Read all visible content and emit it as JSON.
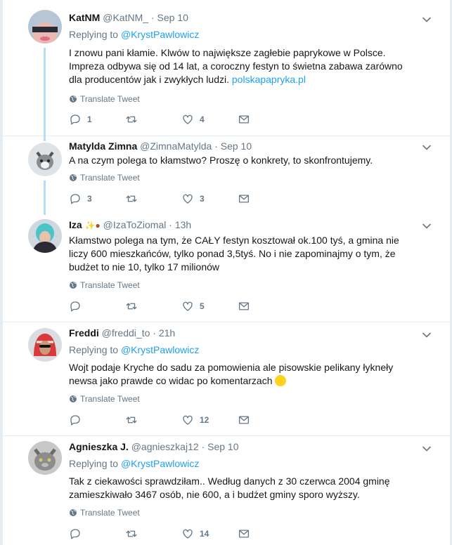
{
  "tweets": [
    {
      "name": "KatNM",
      "handle": "@KatNM_",
      "time": "Sep 10",
      "replying_label": "Replying to",
      "replying_to": "@KrystPawlowicz",
      "text": "I znowu pani kłamie. Klwów to największe zagłebie paprykowe w Polsce. Impreza odbywa się od 14 lat, a coroczny festyn to świetna zabawa zarówno dla producentów jak i zwykłych ludzi.",
      "link": "polskapapryka.pl",
      "translate": "Translate Tweet",
      "replies": "1",
      "retweets": "",
      "likes": "4"
    },
    {
      "name": "Matylda Zimna",
      "handle": "@ZimnaMatylda",
      "time": "Sep 10",
      "text": "A na czym polega to kłamstwo? Proszę o konkrety, to skonfrontujemy.",
      "translate": "Translate Tweet",
      "replies": "3",
      "retweets": "",
      "likes": "3"
    },
    {
      "name": "Iza",
      "handle": "@IzaToZiomal",
      "time": "13h",
      "text": "Kłamstwo polega na tym, że CAŁY festyn kosztował ok.100 tyś, a gmina nie liczy 600 mieszkańców, tylko ponad 3,5tyś. No i nie zapominajmy o tym, że budżet to nie 10, tylko 17 milionów",
      "translate": "Translate Tweet",
      "replies": "",
      "retweets": "",
      "likes": "5"
    },
    {
      "name": "Freddi",
      "handle": "@freddi_to",
      "time": "21h",
      "replying_label": "Replying to",
      "replying_to": "@KrystPawlowicz",
      "text": "Wojt podaje Kryche do sadu za pomowienia ale pisowskie pelikany łykneły newsa jako prawde co widac po komentarzach",
      "translate": "Translate Tweet",
      "replies": "",
      "retweets": "",
      "likes": "12"
    },
    {
      "name": "Agnieszka J.",
      "handle": "@agnieszkaj12",
      "time": "Sep 10",
      "replying_label": "Replying to",
      "replying_to": "@KrystPawlowicz",
      "text": "Tak z ciekawości sprawdziłam..  Według danych z 30 czerwca 2004 gminę zamieszkiwało 3467 osób, nie 600, a i budżet gminy sporo wyższy.",
      "translate": "Translate Tweet",
      "replies": "",
      "retweets": "",
      "likes": "14"
    }
  ],
  "dot": "·",
  "icons": {
    "reply": "reply-icon",
    "retweet": "retweet-icon",
    "like": "heart-icon",
    "dm": "envelope-icon",
    "more": "chevron-down-icon",
    "translate": "globe-icon"
  },
  "colors": {
    "link": "#1da1f2",
    "muted": "#657786",
    "thread": "#b9dcf5"
  }
}
